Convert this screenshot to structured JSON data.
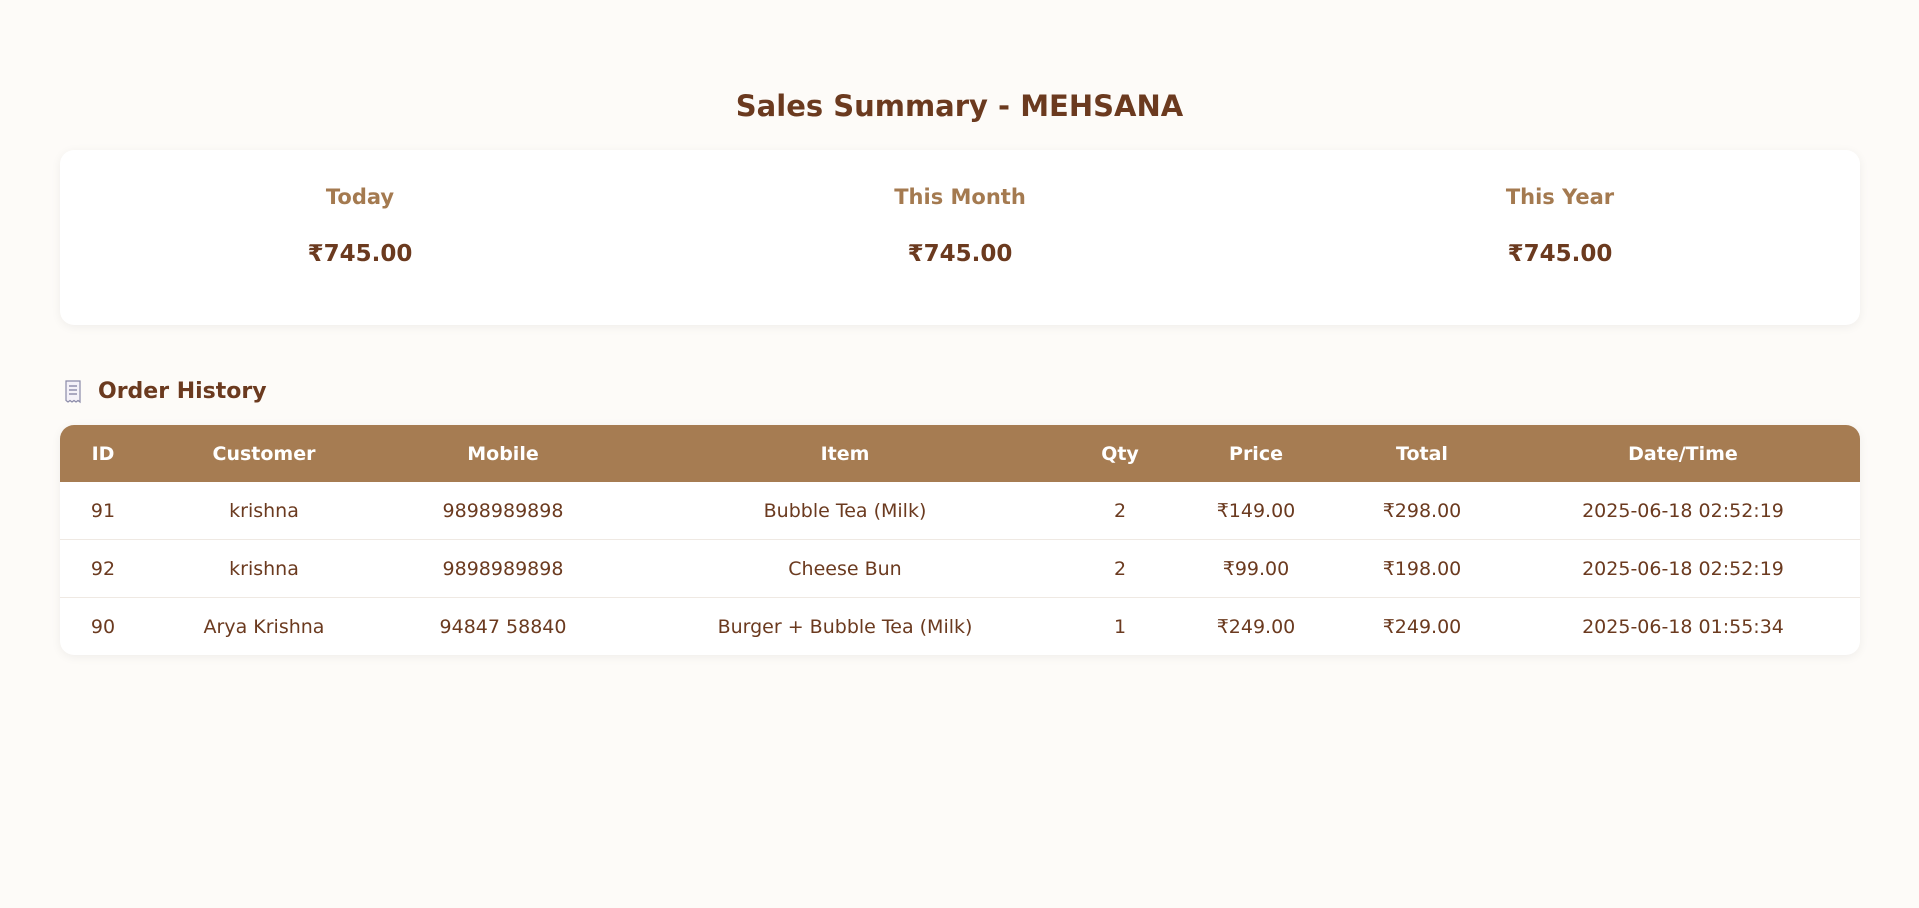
{
  "page": {
    "title": "Sales Summary - MEHSANA"
  },
  "summary": {
    "stats": [
      {
        "label": "Today",
        "value": "₹745.00"
      },
      {
        "label": "This Month",
        "value": "₹745.00"
      },
      {
        "label": "This Year",
        "value": "₹745.00"
      }
    ]
  },
  "orders": {
    "heading": "Order History",
    "icon": "receipt-icon",
    "columns": [
      "ID",
      "Customer",
      "Mobile",
      "Item",
      "Qty",
      "Price",
      "Total",
      "Date/Time"
    ],
    "rows": [
      {
        "id": "91",
        "customer": "krishna",
        "mobile": "9898989898",
        "item": "Bubble Tea (Milk)",
        "qty": "2",
        "price": "₹149.00",
        "total": "₹298.00",
        "datetime": "2025-06-18 02:52:19"
      },
      {
        "id": "92",
        "customer": "krishna",
        "mobile": "9898989898",
        "item": "Cheese Bun",
        "qty": "2",
        "price": "₹99.00",
        "total": "₹198.00",
        "datetime": "2025-06-18 02:52:19"
      },
      {
        "id": "90",
        "customer": "Arya Krishna",
        "mobile": "94847 58840",
        "item": "Burger + Bubble Tea (Milk)",
        "qty": "1",
        "price": "₹249.00",
        "total": "₹249.00",
        "datetime": "2025-06-18 01:55:34"
      }
    ]
  },
  "colors": {
    "background": "#fdfbf8",
    "text_primary": "#6b3a1f",
    "label_accent": "#a47a50",
    "table_header": "#a67c52",
    "card": "#ffffff"
  }
}
